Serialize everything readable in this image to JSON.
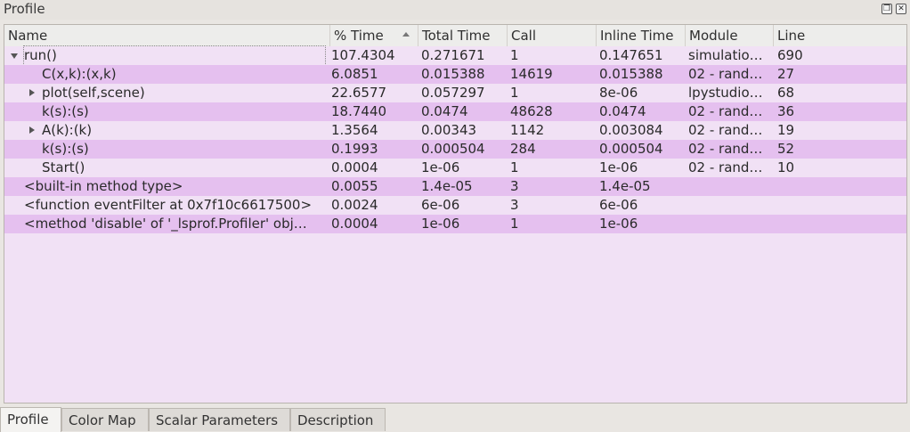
{
  "dock": {
    "title": "Profile",
    "float_glyph": "❐",
    "close_glyph": "✕"
  },
  "columns": [
    "Name",
    "% Time",
    "Total Time",
    "Call",
    "Inline Time",
    "Module",
    "Line"
  ],
  "rows": [
    {
      "name": "run()",
      "pct": "107.4304",
      "total": "0.271671",
      "call": "1",
      "inline": "0.147651",
      "module": "simulatio…",
      "line": "690",
      "expander": "expanded"
    },
    {
      "name": "C(x,k):(x,k)",
      "pct": "6.0851",
      "total": "0.015388",
      "call": "14619",
      "inline": "0.015388",
      "module": "02 - rand…",
      "line": "27",
      "expander": "none"
    },
    {
      "name": "plot(self,scene)",
      "pct": "22.6577",
      "total": "0.057297",
      "call": "1",
      "inline": "8e-06",
      "module": "lpystudio…",
      "line": "68",
      "expander": "collapsed"
    },
    {
      "name": "k(s):(s)",
      "pct": "18.7440",
      "total": "0.0474",
      "call": "48628",
      "inline": "0.0474",
      "module": "02 - rand…",
      "line": "36",
      "expander": "none"
    },
    {
      "name": "A(k):(k)",
      "pct": "1.3564",
      "total": "0.00343",
      "call": "1142",
      "inline": "0.003084",
      "module": "02 - rand…",
      "line": "19",
      "expander": "collapsed"
    },
    {
      "name": "k(s):(s)",
      "pct": "0.1993",
      "total": "0.000504",
      "call": "284",
      "inline": "0.000504",
      "module": "02 - rand…",
      "line": "52",
      "expander": "none"
    },
    {
      "name": "Start()",
      "pct": "0.0004",
      "total": "1e-06",
      "call": "1",
      "inline": "1e-06",
      "module": "02 - rand…",
      "line": "10",
      "expander": "none"
    },
    {
      "name": "<built-in method type>",
      "pct": "0.0055",
      "total": "1.4e-05",
      "call": "3",
      "inline": "1.4e-05",
      "module": "",
      "line": "",
      "expander": "none"
    },
    {
      "name": "<function eventFilter at 0x7f10c6617500>",
      "pct": "0.0024",
      "total": "6e-06",
      "call": "3",
      "inline": "6e-06",
      "module": "",
      "line": "",
      "expander": "none"
    },
    {
      "name": "<method 'disable' of '_lsprof.Profiler' obj…",
      "pct": "0.0004",
      "total": "1e-06",
      "call": "1",
      "inline": "1e-06",
      "module": "",
      "line": "",
      "expander": "none"
    }
  ],
  "tabs": [
    "Profile",
    "Color Map",
    "Scalar Parameters",
    "Description"
  ],
  "colors": {
    "row_dark": "#e5c0ef",
    "row_light": "#f1e1f5"
  }
}
